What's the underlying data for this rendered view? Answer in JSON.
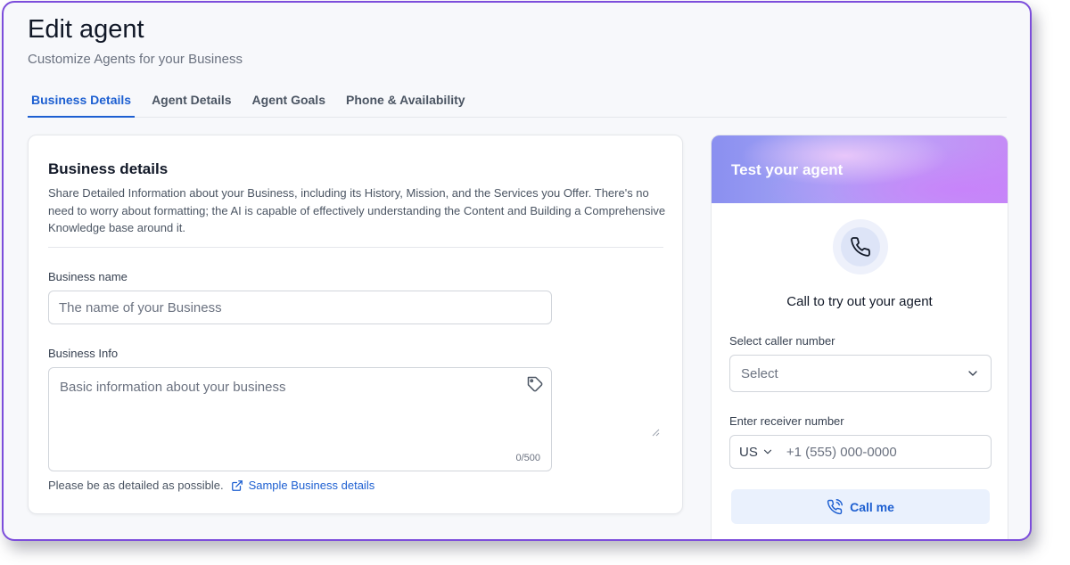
{
  "header": {
    "title": "Edit agent",
    "subtitle": "Customize Agents for your Business"
  },
  "tabs": [
    {
      "label": "Business Details",
      "active": true
    },
    {
      "label": "Agent Details",
      "active": false
    },
    {
      "label": "Agent Goals",
      "active": false
    },
    {
      "label": "Phone & Availability",
      "active": false
    }
  ],
  "business_card": {
    "title": "Business details",
    "description": "Share Detailed Information about your Business, including its History, Mission, and the Services you Offer. There's no need to worry about formatting; the AI is capable of effectively understanding the Content and Building a Comprehensive Knowledge base around it.",
    "name_label": "Business name",
    "name_placeholder": "The name of your Business",
    "name_value": "",
    "info_label": "Business Info",
    "info_placeholder": "Basic information about your business",
    "info_value": "",
    "char_count": "0/500",
    "helper_text": "Please be as detailed as possible.",
    "sample_link": "Sample Business details"
  },
  "test_panel": {
    "title": "Test your agent",
    "prompt": "Call to try out your agent",
    "caller_label": "Select caller number",
    "caller_select_value": "Select",
    "receiver_label": "Enter receiver number",
    "country_code": "US",
    "phone_placeholder": "+1 (555) 000-0000",
    "call_button": "Call me"
  },
  "colors": {
    "accent": "#1d5fd1",
    "frame_border": "#7c4ddb",
    "header_gradient_start": "#8a8ff0",
    "header_gradient_end": "#c48bf6"
  },
  "icons": {
    "tag": "tag-icon",
    "external_link": "external-link-icon",
    "phone": "phone-icon",
    "chevron": "chevron-down-icon",
    "phone_call": "phone-call-icon"
  }
}
